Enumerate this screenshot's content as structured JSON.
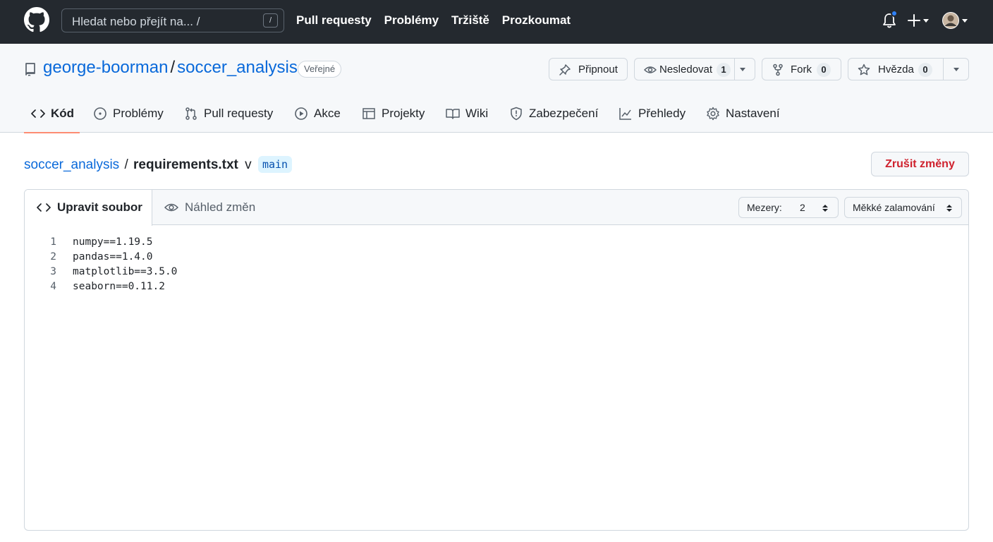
{
  "header": {
    "search_placeholder": "Hledat nebo přejít na... /",
    "search_shortcut": "/",
    "nav": [
      "Pull requesty",
      "Problémy",
      "Tržiště",
      "Prozkoumat"
    ],
    "notification_dot_color": "#2f81f7"
  },
  "repo": {
    "owner": "george-boorman",
    "separator": "/",
    "name": "soccer_analysis",
    "visibility": "Veřejné",
    "actions": {
      "pin_label": "Připnout",
      "watch_label": "Nesledovat",
      "watch_count": "1",
      "fork_label": "Fork",
      "fork_count": "0",
      "star_label": "Hvězda",
      "star_count": "0"
    },
    "tabs": [
      {
        "label": "Kód",
        "icon": "code-icon",
        "active": true
      },
      {
        "label": "Problémy",
        "icon": "issue-icon"
      },
      {
        "label": "Pull requesty",
        "icon": "pull-request-icon"
      },
      {
        "label": "Akce",
        "icon": "play-icon"
      },
      {
        "label": "Projekty",
        "icon": "table-icon"
      },
      {
        "label": "Wiki",
        "icon": "book-icon"
      },
      {
        "label": "Zabezpečení",
        "icon": "shield-icon"
      },
      {
        "label": "Přehledy",
        "icon": "graph-icon"
      },
      {
        "label": "Nastavení",
        "icon": "gear-icon"
      }
    ]
  },
  "breadcrumb": {
    "repo": "soccer_analysis",
    "separator": "/",
    "file": "requirements.txt",
    "in_word": "v",
    "branch": "main"
  },
  "cancel_label": "Zrušit změny",
  "editor": {
    "edit_tab": "Upravit soubor",
    "preview_tab": "Náhled změn",
    "indent_label": "Mezery:",
    "indent_value": "2",
    "wrap_label": "Měkké zalamování",
    "lines": [
      {
        "num": "1",
        "text": "numpy==1.19.5"
      },
      {
        "num": "2",
        "text": "pandas==1.4.0"
      },
      {
        "num": "3",
        "text": "matplotlib==3.5.0"
      },
      {
        "num": "4",
        "text": "seaborn==0.11.2"
      }
    ]
  }
}
